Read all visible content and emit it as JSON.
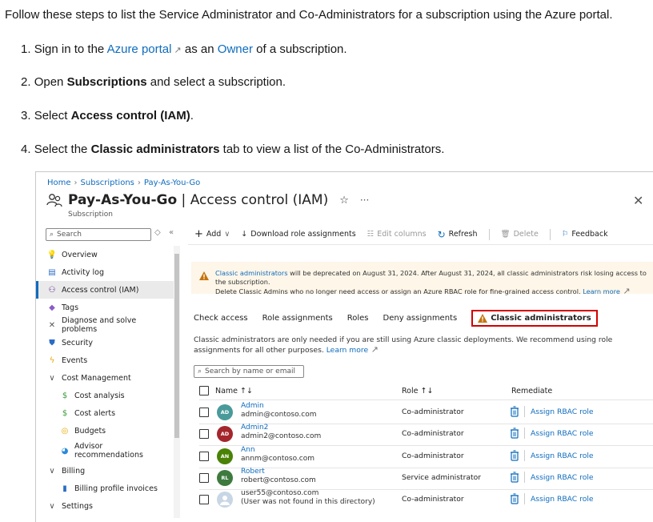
{
  "doc": {
    "intro": "Follow these steps to list the Service Administrator and Co-Administrators for a subscription using the Azure portal.",
    "step1": {
      "num": "1.",
      "pre": "Sign in to the",
      "link1": "Azure portal",
      "mid": "as an",
      "link2": "Owner",
      "post": "of a subscription."
    },
    "step2": {
      "num": "2.",
      "pre": "Open",
      "bold": "Subscriptions",
      "post": "and select a subscription."
    },
    "step3": {
      "num": "3.",
      "pre": "Select",
      "bold": "Access control (IAM)",
      "post": "."
    },
    "step4": {
      "num": "4.",
      "pre": "Select the",
      "bold": "Classic administrators",
      "post": "tab to view a list of the Co-Administrators."
    }
  },
  "portal": {
    "breadcrumb": [
      "Home",
      "Subscriptions",
      "Pay-As-You-Go"
    ],
    "title_bold": "Pay-As-You-Go",
    "title_rest": " | Access control (IAM)",
    "subtitle": "Subscription",
    "sidebar_search": "Search",
    "sidebar": [
      {
        "label": "Overview",
        "icon": "key-icon",
        "glyph": "💡",
        "color": "#e8a700",
        "indent": false
      },
      {
        "label": "Activity log",
        "icon": "activity-log-icon",
        "glyph": "▤",
        "color": "#2b6cc4",
        "indent": false
      },
      {
        "label": "Access control (IAM)",
        "icon": "people-icon",
        "glyph": "⚇",
        "color": "#5c2d91",
        "indent": false,
        "active": true
      },
      {
        "label": "Tags",
        "icon": "tag-icon",
        "glyph": "◆",
        "color": "#8a5cc7",
        "indent": false
      },
      {
        "label": "Diagnose and solve problems",
        "icon": "wrench-icon",
        "glyph": "✕",
        "color": "#555",
        "indent": false
      },
      {
        "label": "Security",
        "icon": "shield-icon",
        "glyph": "⛊",
        "color": "#2b6cc4",
        "indent": false
      },
      {
        "label": "Events",
        "icon": "lightning-icon",
        "glyph": "ϟ",
        "color": "#e8a700",
        "indent": false
      },
      {
        "label": "Cost Management",
        "icon": "chevron-down-icon",
        "glyph": "∨",
        "color": "#555",
        "indent": false
      },
      {
        "label": "Cost analysis",
        "icon": "cost-analysis-icon",
        "glyph": "$",
        "color": "#3a9b3a",
        "indent": true
      },
      {
        "label": "Cost alerts",
        "icon": "cost-alerts-icon",
        "glyph": "$",
        "color": "#3a9b3a",
        "indent": true
      },
      {
        "label": "Budgets",
        "icon": "budgets-icon",
        "glyph": "◎",
        "color": "#e8a700",
        "indent": true
      },
      {
        "label": "Advisor\nrecommendations",
        "icon": "advisor-icon",
        "glyph": "◕",
        "color": "#2b8ad8",
        "indent": true
      },
      {
        "label": "Billing",
        "icon": "chevron-down-icon",
        "glyph": "∨",
        "color": "#555",
        "indent": false
      },
      {
        "label": "Billing profile invoices",
        "icon": "invoice-icon",
        "glyph": "▮",
        "color": "#2b6cc4",
        "indent": true
      },
      {
        "label": "Settings",
        "icon": "chevron-down-icon",
        "glyph": "∨",
        "color": "#555",
        "indent": false
      }
    ],
    "toolbar": {
      "add": "Add",
      "download": "Download role assignments",
      "edit_columns": "Edit columns",
      "refresh": "Refresh",
      "delete": "Delete",
      "feedback": "Feedback"
    },
    "banner": {
      "link1": "Classic administrators",
      "text1": " will be deprecated on August 31, 2024. After August 31, 2024, all classic administrators risk losing access to the subscription.",
      "text2": "Delete Classic Admins who no longer need access or assign an Azure RBAC role for fine-grained access control. ",
      "link2": "Learn more"
    },
    "tabs": [
      "Check access",
      "Role assignments",
      "Roles",
      "Deny assignments",
      "Classic administrators"
    ],
    "note_text": "Classic administrators are only needed if you are still using Azure classic deployments. We recommend using role assignments for all other purposes. ",
    "note_link": "Learn more",
    "table_search_placeholder": "Search by name or email",
    "columns": {
      "name": "Name ↑↓",
      "role": "Role ↑↓",
      "remediate": "Remediate"
    },
    "rows": [
      {
        "initials": "AD",
        "color": "#4a9a9a",
        "name": "Admin",
        "email": "admin@contoso.com",
        "role": "Co-administrator",
        "action": "Assign RBAC role"
      },
      {
        "initials": "AD",
        "color": "#a4262c",
        "name": "Admin2",
        "email": "admin2@contoso.com",
        "role": "Co-administrator",
        "action": "Assign RBAC role"
      },
      {
        "initials": "AN",
        "color": "#498205",
        "name": "Ann",
        "email": "annm@contoso.com",
        "role": "Co-administrator",
        "action": "Assign RBAC role"
      },
      {
        "initials": "RL",
        "color": "#3e7a3e",
        "name": "Robert",
        "email": "robert@contoso.com",
        "role": "Service administrator",
        "action": "Assign RBAC role"
      },
      {
        "initials": "",
        "color": "#c8d6e5",
        "name": "user55@contoso.com",
        "email": "(User was not found in this directory)",
        "role": "Co-administrator",
        "action": "Assign RBAC role"
      }
    ]
  }
}
